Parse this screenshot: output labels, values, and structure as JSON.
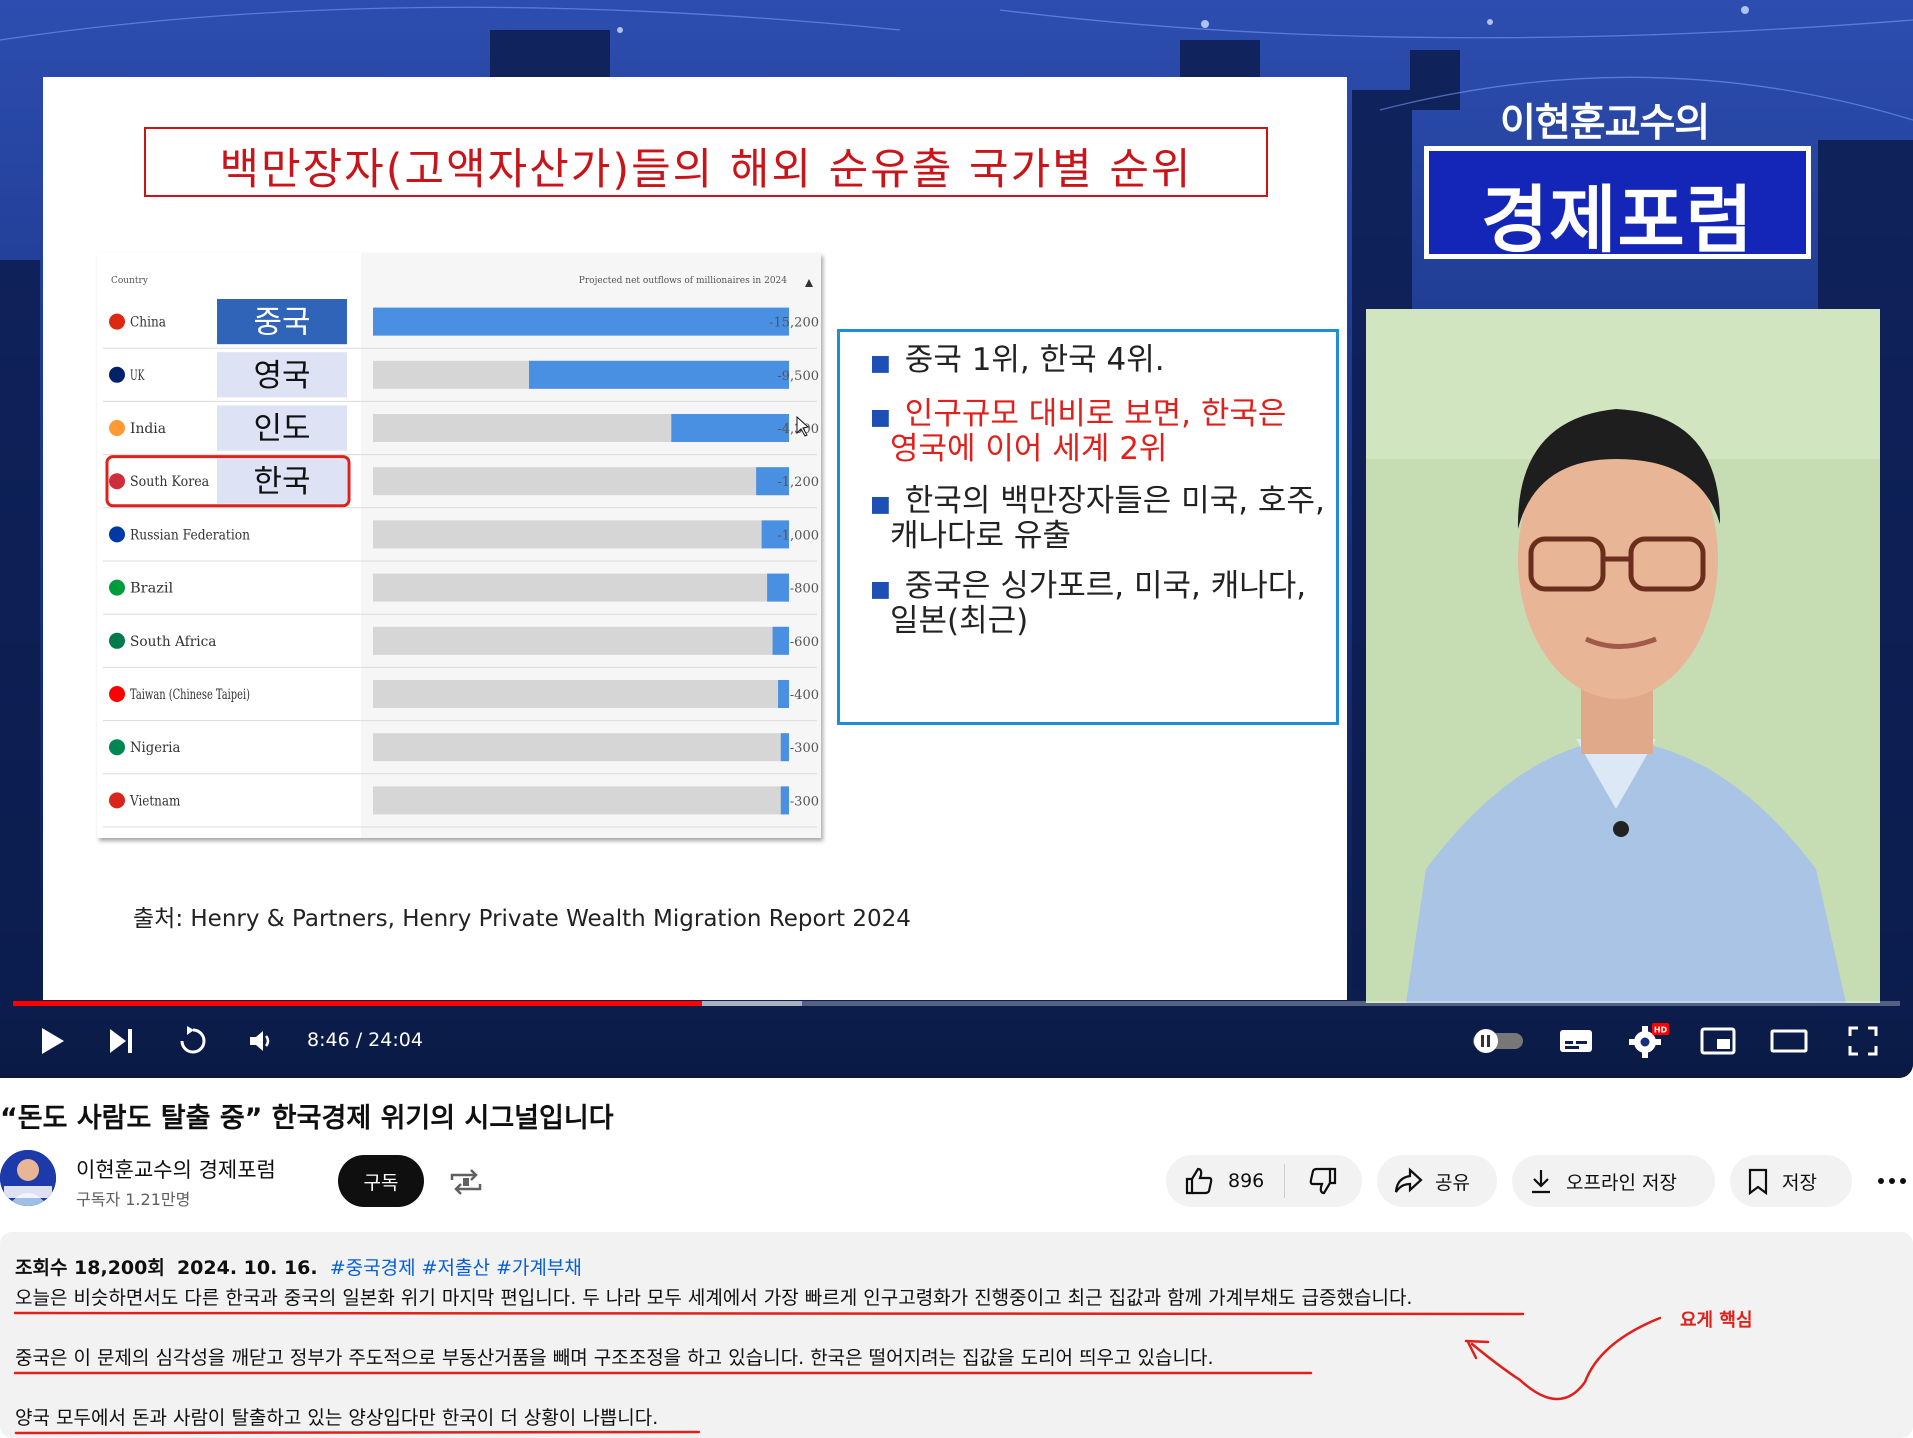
{
  "slide": {
    "title": "백만장자(고액자산가)들의 해외 순유출 국가별 순위",
    "bullets": [
      {
        "text": "중국 1위, 한국 4위.",
        "red": false
      },
      {
        "text": "인구규모 대비로 보면, 한국은",
        "red": true
      },
      {
        "text": "영국에 이어 세계 2위",
        "red": true
      },
      {
        "text": "한국의 백만장자들은 미국, 호주,",
        "red": false
      },
      {
        "text": "캐나다로 유출",
        "red": false
      },
      {
        "text": "중국은 싱가포르, 미국, 캐나다,",
        "red": false
      },
      {
        "text": "일본(최근)",
        "red": false
      }
    ],
    "source": "출처: Henry & Partners, Henry Private Wealth Migration Report 2024"
  },
  "brand": {
    "sub": "이현훈교수의",
    "main": "경제포럼"
  },
  "chart_data": {
    "type": "bar",
    "orientation": "horizontal",
    "column_headers": [
      "Country",
      "Projected net outflows of millionaires in 2024"
    ],
    "categories": [
      "China",
      "UK",
      "India",
      "South Korea",
      "Russian Federation",
      "Brazil",
      "South Africa",
      "Taiwan (Chinese Taipei)",
      "Nigeria",
      "Vietnam"
    ],
    "korean_labels": [
      "중국",
      "영국",
      "인도",
      "한국"
    ],
    "values": [
      -15200,
      -9500,
      -4300,
      -1200,
      -1000,
      -800,
      -600,
      -400,
      -300,
      -300
    ],
    "value_labels": [
      "-15,200",
      "-9,500",
      "-4,300",
      "-1,200",
      "-1,000",
      "-800",
      "-600",
      "-400",
      "-300",
      "-300"
    ],
    "flag_colors": [
      "#de2910",
      "#012169",
      "#ff9933",
      "#cd2e3a",
      "#0039a6",
      "#009c3b",
      "#007a4d",
      "#fe0000",
      "#008751",
      "#da251d"
    ],
    "highlight": "South Korea",
    "bar_color": "#4a90e2",
    "track_color": "#d6d6d6",
    "xlim": [
      -15200,
      0
    ]
  },
  "player": {
    "current_time": "8:46",
    "duration": "24:04",
    "time_display": "8:46 / 24:04",
    "progress": 0.365,
    "buffered": 0.418,
    "hd_badge": "HD"
  },
  "video": {
    "title": "“돈도 사람도 탈출 중” 한국경제 위기의 시그널입니다"
  },
  "channel": {
    "name": "이현훈교수의 경제포럼",
    "subscribers": "구독자 1.21만명",
    "subscribe_label": "구독"
  },
  "actions": {
    "likes": "896",
    "share": "공유",
    "offline": "오프라인 저장",
    "save": "저장"
  },
  "description": {
    "views": "조회수 18,200회",
    "date": "2024. 10. 16.",
    "hashtags": [
      "#중국경제",
      "#저출산",
      "#가계부채"
    ],
    "lines": [
      "오늘은 비슷하면서도 다른 한국과 중국의 일본화 위기 마지막 편입니다. 두 나라 모두 세계에서 가장 빠르게 인구고령화가 진행중이고 최근 집값과 함께 가계부채도 급증했습니다.",
      "중국은 이 문제의 심각성을 깨닫고 정부가 주도적으로 부동산거품을 빼며 구조조정을 하고 있습니다. 한국은 떨어지려는 집값을 도리어 띄우고 있습니다.",
      "양국 모두에서 돈과 사람이 탈출하고 있는 양상입다만 한국이 더 상황이 나쁩니다."
    ],
    "annotation": "요게 핵심",
    "annotation_color": "#e0201b"
  },
  "icons": [
    "play-icon",
    "next-icon",
    "autoplay-icon",
    "volume-icon",
    "autoplay-toggle-icon",
    "subtitles-icon",
    "settings-icon",
    "miniplayer-icon",
    "theater-icon",
    "fullscreen-icon",
    "repost-icon",
    "like-icon",
    "dislike-icon",
    "share-icon",
    "download-icon",
    "bookmark-icon",
    "more-icon"
  ]
}
